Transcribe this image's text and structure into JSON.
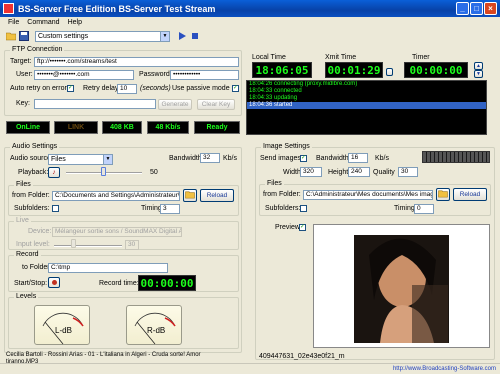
{
  "window": {
    "title": "BS-Server Free Edition BS-Server Test Stream"
  },
  "menu": [
    "File",
    "Command",
    "Help"
  ],
  "toolbar": {
    "profile": "Custom settings"
  },
  "ftp": {
    "group_label": "FTP Connection",
    "target_label": "Target:",
    "target_value": "ftp://•••••••.com/streams/test",
    "user_label": "User:",
    "user_value": "•••••••@•••••••.com",
    "password_label": "Password:",
    "password_value": "••••••••••••",
    "auto_retry_label": "Auto retry on error",
    "retry_delay_label": "Retry delay:",
    "retry_delay_value": "10",
    "seconds_label": "(seconds)",
    "passive_label": "Use passive mode",
    "key_label": "Key:",
    "generate_label": "Generate",
    "clear_key_label": "Clear Key"
  },
  "status": {
    "online": "OnLine",
    "link": "LINK",
    "bytes": "408 KB",
    "rate": "48 Kb/s",
    "ready": "Ready"
  },
  "clocks": {
    "local_label": "Local Time",
    "local_value": "18:06:05",
    "xmit_label": "Xmit Time",
    "xmit_value": "00:01:29",
    "timer_label": "Timer",
    "timer_value": "00:00:00"
  },
  "log": [
    "18:04:26 connecting (proxy.midlbre.com)",
    "18:04:33 connected",
    "18:04:33 updating",
    "18:04:36 started"
  ],
  "audio": {
    "group_label": "Audio Settings",
    "source_label": "Audio source:",
    "source_value": "Files",
    "bandwidth_label": "Bandwidth",
    "bandwidth_value": "32",
    "bandwidth_unit": "Kb/s",
    "playback_label": "Playback:",
    "playback_value": "50",
    "files_label": "Files",
    "from_folder_label": "from Folder:",
    "from_folder_value": "C:\\Documents and Settings\\Administrateur\\Mes d",
    "reload_label": "Reload",
    "subfolders_label": "Subfolders:",
    "timing_label": "Timing",
    "timing_value": "3",
    "live_label": "Live",
    "device_label": "Device:",
    "device_value": "Mélangeur sortie sons / SoundMAX Digital Audio",
    "input_level_label": "Input level:",
    "input_level_value": "30",
    "record_label": "Record",
    "to_folder_label": "to Folder:",
    "to_folder_value": "C:\\tmp",
    "startstop_label": "Start/Stop:",
    "record_time_label": "Record time:",
    "record_time_value": "00:00:00",
    "levels_label": "Levels",
    "meter_left": "L-dB",
    "meter_right": "R-dB",
    "now_playing": "Cecilia Bartoli - Rossini Arias - 01 - L'italiana in Algeri - Cruda sorte! Amor tiranno.MP3"
  },
  "image": {
    "group_label": "Image Settings",
    "send_images_label": "Send images:",
    "bandwidth_label": "Bandwidth",
    "bandwidth_value": "16",
    "bandwidth_unit": "Kb/s",
    "width_label": "Width",
    "width_value": "320",
    "height_label": "Height",
    "height_value": "240",
    "quality_label": "Quality",
    "quality_value": "30",
    "files_label": "Files",
    "from_folder_label": "from Folder:",
    "from_folder_value": "C:\\Administrateur\\Mes documents\\Mes images\\test",
    "reload_label": "Reload",
    "subfolders_label": "Subfolders:",
    "timing_label": "Timing",
    "timing_value": "0",
    "preview_label": "Preview",
    "filename": "409447631_02e43e0f21_m"
  },
  "statusbar": {
    "url": "http://www.Broadcasting-Software.com"
  },
  "colors": {
    "led_green": "#1cff1c",
    "title_blue": "#0a5fd8",
    "log_select": "#3163c5"
  }
}
